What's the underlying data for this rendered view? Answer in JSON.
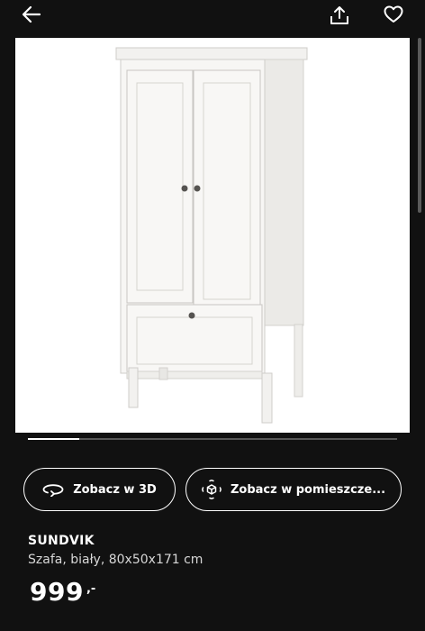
{
  "header": {
    "back_icon": "arrow-left-icon",
    "share_icon": "share-upload-icon",
    "favourite_icon": "heart-outline-icon"
  },
  "gallery": {
    "image": "white-wardrobe-product-photo",
    "progress": 0.14
  },
  "actions": {
    "view_3d_label": "Zobacz w 3D",
    "view_3d_icon": "rotate-3d-icon",
    "view_room_label": "Zobacz w pomieszcze...",
    "view_room_icon": "ar-cube-icon"
  },
  "product": {
    "name": "SUNDVIK",
    "description": "Szafa, biały, 80x50x171 cm",
    "price": "999",
    "price_suffix": ",-"
  },
  "colors": {
    "background": "#111111",
    "text": "#ffffff",
    "subtle_text": "#d7d7d7"
  }
}
